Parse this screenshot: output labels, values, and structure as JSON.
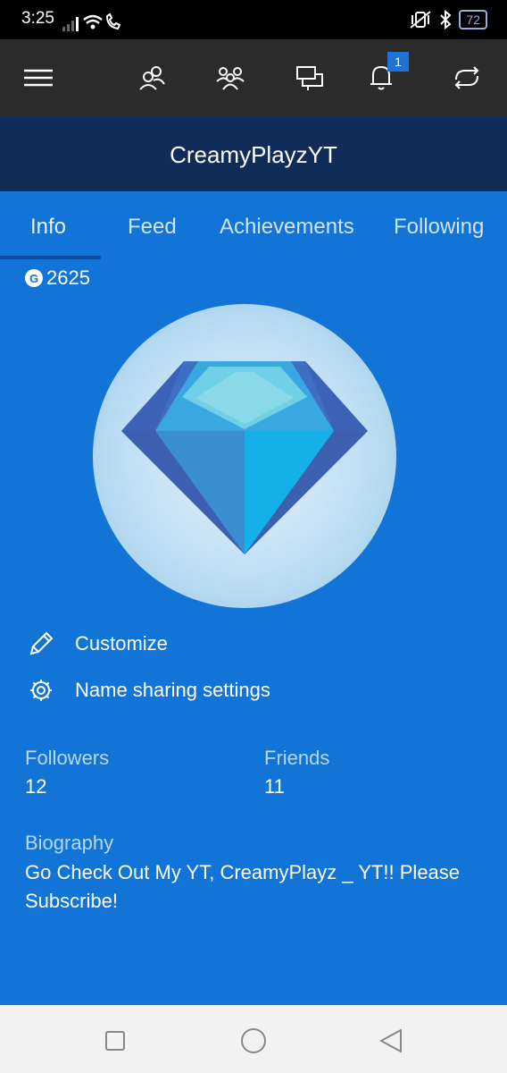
{
  "status_bar": {
    "time": "3:25",
    "battery": "72"
  },
  "top_nav": {
    "icons": [
      "menu-icon",
      "friends-icon",
      "party-icon",
      "messages-icon",
      "notifications-icon",
      "sync-icon"
    ],
    "notification_count": "1"
  },
  "profile": {
    "gamertag": "CreamyPlayzYT",
    "gamerscore_badge": "G",
    "gamerscore": "2625"
  },
  "tabs": [
    {
      "label": "Info",
      "active": true
    },
    {
      "label": "Feed",
      "active": false
    },
    {
      "label": "Achievements",
      "active": false
    },
    {
      "label": "Following",
      "active": false
    }
  ],
  "actions": {
    "customize": "Customize",
    "name_sharing": "Name sharing settings"
  },
  "stats": {
    "followers_label": "Followers",
    "followers_value": "12",
    "friends_label": "Friends",
    "friends_value": "11"
  },
  "biography": {
    "label": "Biography",
    "text": "Go Check Out My YT, CreamyPlayz _ YT!! Please Subscribe!"
  },
  "colors": {
    "primary_bg": "#1174d6",
    "title_bar": "#0f2d58",
    "nav_bar": "#2b2b2b",
    "badge": "#1e73d7"
  }
}
